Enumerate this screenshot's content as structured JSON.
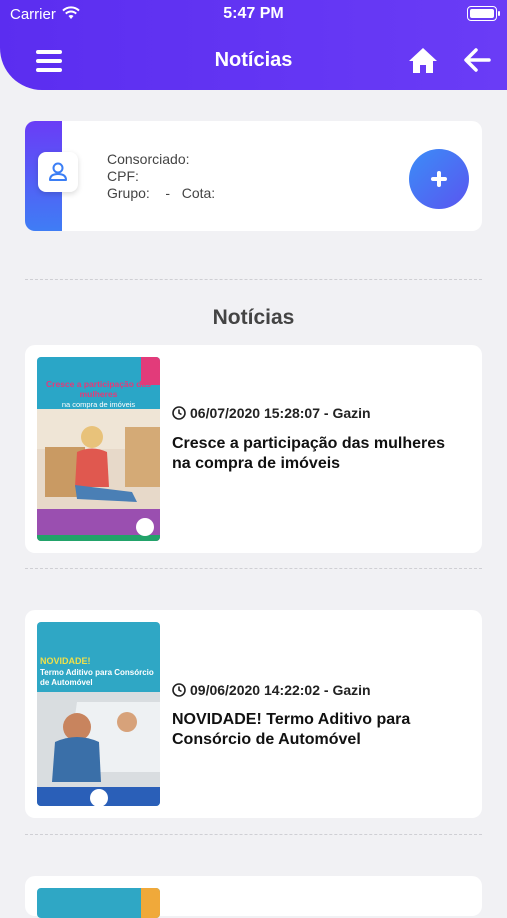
{
  "status_bar": {
    "carrier": "Carrier",
    "time": "5:47 PM"
  },
  "header": {
    "title": "Notícias"
  },
  "profile": {
    "consorciado_label": "Consorciado:",
    "cpf_label": "CPF:",
    "grupo_label": "Grupo:",
    "separator": "-",
    "cota_label": "Cota:"
  },
  "section": {
    "title": "Notícias"
  },
  "news": [
    {
      "date": "06/07/2020 15:28:07 - Gazin",
      "headline": "Cresce a participação das mulheres na compra de imóveis",
      "thumb_title": "Cresce a participação das mulheres",
      "thumb_subtitle": "na compra de imóveis"
    },
    {
      "date": "09/06/2020 14:22:02 - Gazin",
      "headline": "NOVIDADE! Termo Aditivo para Consórcio de Automóvel",
      "thumb_title": "NOVIDADE!",
      "thumb_subtitle": "Termo Aditivo para Consórcio de Automóvel"
    }
  ],
  "colors": {
    "header": "#5b2df0",
    "accent_blue": "#3b8df7",
    "card": "#ffffff",
    "background": "#f1f1f4"
  }
}
